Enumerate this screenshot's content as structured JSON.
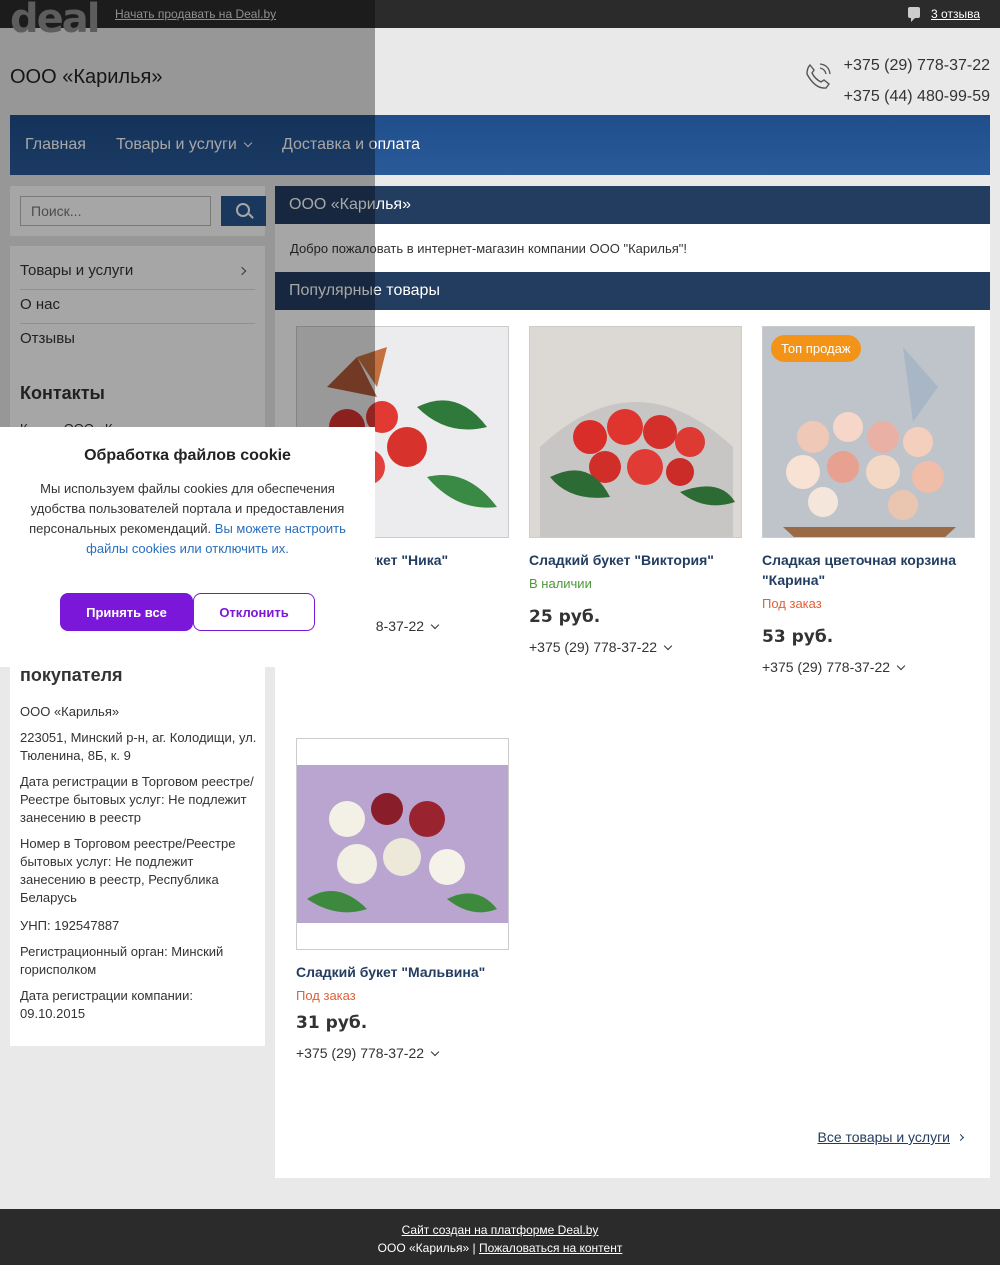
{
  "topbar": {
    "logo": "deal",
    "sell_link": "Начать продавать на Deal.by",
    "reviews_link": "3 отзыва"
  },
  "header": {
    "company": "ООО «Карилья»",
    "phone1": "+375 (29) 778-37-22",
    "phone2": "+375 (44) 480-99-59"
  },
  "nav": {
    "home": "Главная",
    "products": "Товары и услуги",
    "delivery": "Доставка и оплата"
  },
  "search": {
    "placeholder": "Поиск..."
  },
  "sidebar": {
    "menu": [
      "Товары и услуги",
      "О нас",
      "Отзывы"
    ],
    "contacts_title": "Контакты",
    "contacts_partial": "К          ООО «К",
    "buyer_info_title": "покупателя",
    "info": [
      "ООО «Карилья»",
      "223051, Минский р-н, аг. Колодищи, ул. Тюленина, 8Б, к. 9",
      "Дата регистрации в Торговом реестре/Реестре бытовых услуг: Не подлежит занесению в реестр",
      "Номер в Торговом реестре/Реестре бытовых услуг: Не подлежит занесению в реестр, Республика Беларусь",
      "УНП: 192547887",
      "Регистрационный орган: Минский горисполком",
      "Дата регистрации компании: 09.10.2015"
    ]
  },
  "main": {
    "title": "ООО «Карилья»",
    "welcome": "Добро пожаловать в интернет-магазин компании ООО \"Карилья\"!",
    "popular_title": "Популярные товары",
    "all_link": "Все товары и услуги"
  },
  "products": [
    {
      "name": "Сладкий букет \"Ника\"",
      "status": "",
      "price": "",
      "phone": "+375 (29) 778-37-22"
    },
    {
      "name": "Сладкий букет \"Виктория\"",
      "status": "В наличии",
      "price": "25 руб.",
      "phone": "+375 (29) 778-37-22"
    },
    {
      "name": "Сладкая цветочная корзина \"Карина\"",
      "status": "Под заказ",
      "price": "53 руб.",
      "phone": "+375 (29) 778-37-22",
      "badge": "Топ продаж"
    },
    {
      "name": "Сладкий букет \"Мальвина\"",
      "status": "Под заказ",
      "price": "31 руб.",
      "phone": "+375 (29) 778-37-22"
    }
  ],
  "cookie": {
    "title": "Обработка файлов cookie",
    "text": "Мы используем файлы cookies для обеспечения удобства пользователей портала и предоставления персональных рекомендаций.",
    "link": "Вы можете настроить файлы cookies или отключить их.",
    "accept": "Принять все",
    "decline": "Отклонить"
  },
  "footer": {
    "created": "Сайт создан на платформе Deal.by",
    "company": "ООО «Карилья» |",
    "report": "Пожаловаться на контент"
  },
  "colors": {
    "accent": "#233d61",
    "nav": "#28558f",
    "in_stock": "#4a9a3a",
    "on_order": "#e0603a",
    "badge": "#f39317",
    "cookie_btn": "#7b17d9"
  }
}
